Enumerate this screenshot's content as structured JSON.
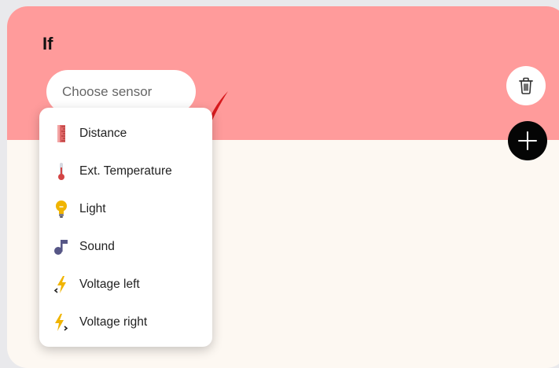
{
  "rule": {
    "title": "If",
    "sensor_placeholder": "Choose sensor"
  },
  "buttons": {
    "delete_icon": "trash-icon",
    "add_icon": "plus-icon"
  },
  "dropdown": {
    "items": [
      {
        "label": "Distance",
        "icon": "ruler-icon"
      },
      {
        "label": "Ext. Temperature",
        "icon": "thermometer-icon"
      },
      {
        "label": "Light",
        "icon": "light-bulb-icon"
      },
      {
        "label": "Sound",
        "icon": "music-note-icon"
      },
      {
        "label": "Voltage left",
        "icon": "lightning-left-icon"
      },
      {
        "label": "Voltage right",
        "icon": "lightning-right-icon"
      }
    ]
  },
  "colors": {
    "header": "#ff9b9b",
    "card_body": "#fdf8f2",
    "add_button": "#050505",
    "checkmark": "#d7191d"
  }
}
